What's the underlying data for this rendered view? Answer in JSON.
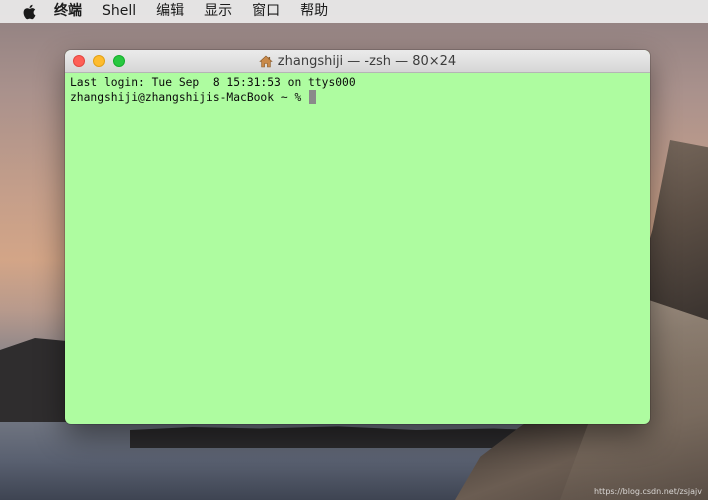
{
  "menubar": {
    "apple_icon": "apple-logo-icon",
    "items": [
      {
        "label": "终端"
      },
      {
        "label": "Shell"
      },
      {
        "label": "编辑"
      },
      {
        "label": "显示"
      },
      {
        "label": "窗口"
      },
      {
        "label": "帮助"
      }
    ]
  },
  "window": {
    "title": "zhangshiji — -zsh — 80×24",
    "title_icon": "home-icon",
    "background_color": "#aefca0",
    "buttons": {
      "close_color": "#fe5f57",
      "minimize_color": "#febc2e",
      "zoom_color": "#28c840"
    }
  },
  "terminal": {
    "lines": [
      {
        "text": "Last login: Tue Sep  8 15:31:53 on ttys000"
      },
      {
        "text": "zhangshiji@zhangshijis-MacBook ~ % "
      }
    ],
    "cursor": "block-cursor"
  },
  "watermark": "https://blog.csdn.net/zsjajv"
}
